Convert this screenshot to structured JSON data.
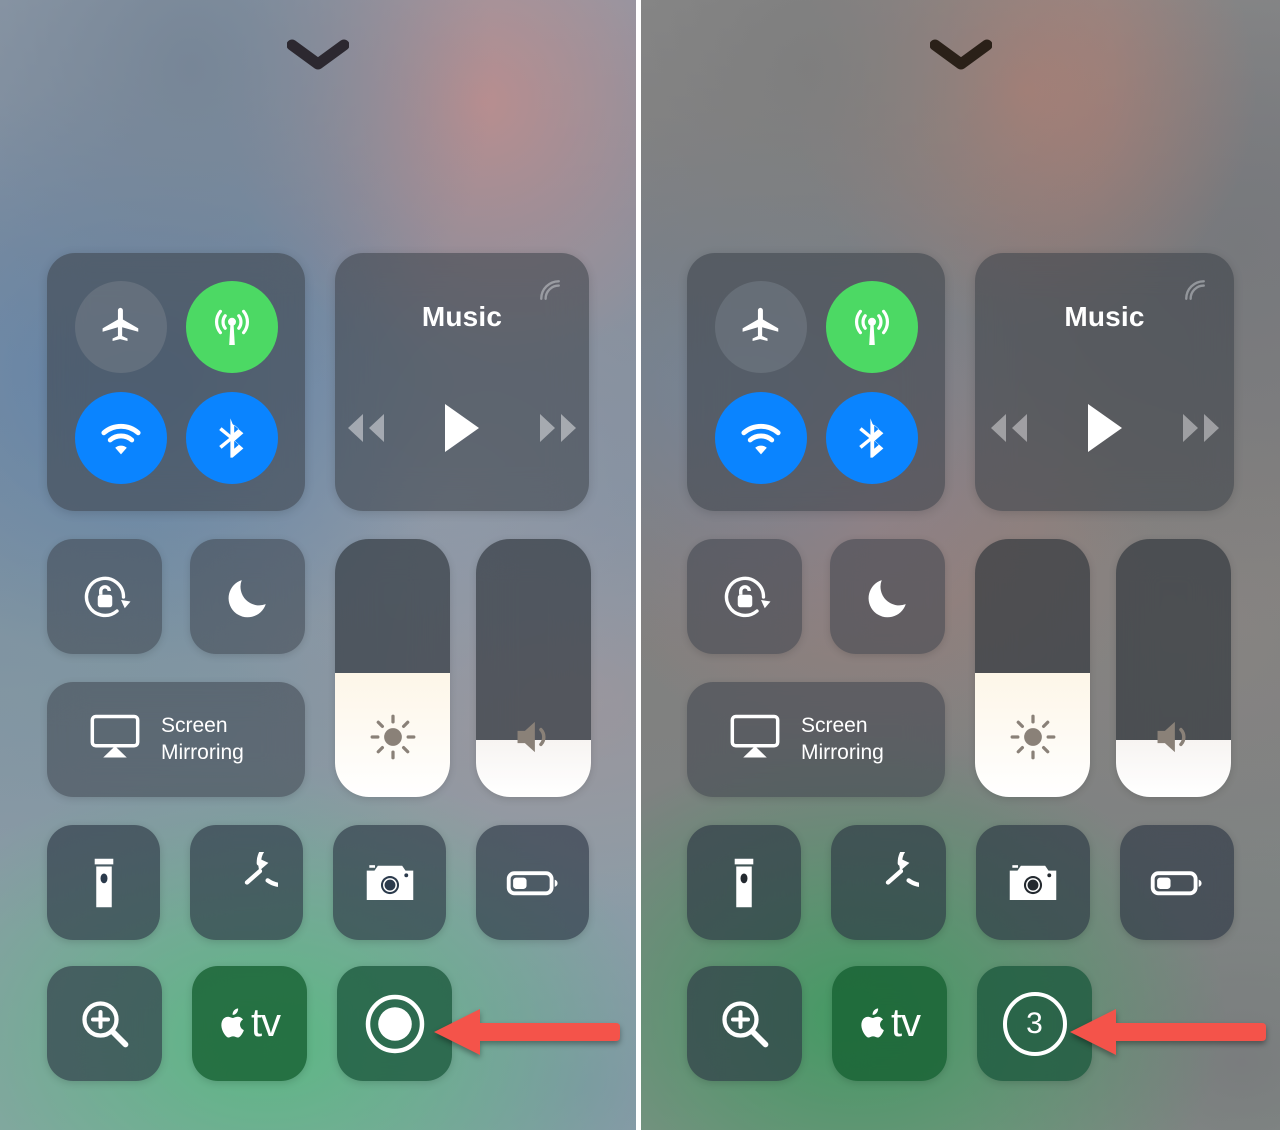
{
  "screenshot": {
    "title": "iOS Control Center comparison",
    "panels": [
      {
        "id": "before",
        "chevron": "chevron-down-icon",
        "connectivity": {
          "airplane": {
            "label": "Airplane Mode",
            "icon": "airplane-icon",
            "state": "off",
            "color": "#78808a"
          },
          "cellular": {
            "label": "Cellular Data",
            "icon": "cellular-antenna-icon",
            "state": "on",
            "color": "#4cd964"
          },
          "wifi": {
            "label": "Wi-Fi",
            "icon": "wifi-icon",
            "state": "on",
            "color": "#0a84ff"
          },
          "bluetooth": {
            "label": "Bluetooth",
            "icon": "bluetooth-icon",
            "state": "on",
            "color": "#0a84ff"
          }
        },
        "music": {
          "title": "Music",
          "airplay_icon": "airplay-audio-icon",
          "rewind_icon": "rewind-icon",
          "play_icon": "play-icon",
          "forward_icon": "fast-forward-icon",
          "playing": false
        },
        "orientation_lock": {
          "label": "Rotation Lock",
          "icon": "rotation-lock-icon",
          "state": "off"
        },
        "do_not_disturb": {
          "label": "Do Not Disturb",
          "icon": "moon-icon",
          "state": "off"
        },
        "screen_mirroring": {
          "line1": "Screen",
          "line2": "Mirroring",
          "icon": "airplay-screen-icon"
        },
        "brightness": {
          "label": "Brightness",
          "icon": "sun-icon",
          "value": 48
        },
        "volume": {
          "label": "Volume",
          "icon": "speaker-icon",
          "value": 22
        },
        "tiles": [
          {
            "label": "Flashlight",
            "icon": "flashlight-icon",
            "style": "dark"
          },
          {
            "label": "Timer",
            "icon": "timer-icon",
            "style": "dark"
          },
          {
            "label": "Camera",
            "icon": "camera-icon",
            "style": "dark"
          },
          {
            "label": "Low Power Mode",
            "icon": "battery-icon",
            "style": "dark"
          },
          {
            "label": "Magnifier",
            "icon": "magnifier-plus-icon",
            "style": "dark"
          },
          {
            "label": "Apple TV Remote",
            "icon": "apple-tv-icon",
            "style": "green",
            "text": "tv"
          },
          {
            "label": "Screen Recording",
            "icon": "record-icon",
            "style": "greenrec"
          }
        ],
        "annotation": {
          "type": "arrow-left",
          "color": "#f4534a",
          "points_to": "Screen Recording"
        }
      },
      {
        "id": "after",
        "chevron": "chevron-down-icon",
        "connectivity": {
          "airplane": {
            "label": "Airplane Mode",
            "icon": "airplane-icon",
            "state": "off",
            "color": "#78808a"
          },
          "cellular": {
            "label": "Cellular Data",
            "icon": "cellular-antenna-icon",
            "state": "on",
            "color": "#4cd964"
          },
          "wifi": {
            "label": "Wi-Fi",
            "icon": "wifi-icon",
            "state": "on",
            "color": "#0a84ff"
          },
          "bluetooth": {
            "label": "Bluetooth",
            "icon": "bluetooth-icon",
            "state": "on",
            "color": "#0a84ff"
          }
        },
        "music": {
          "title": "Music",
          "airplay_icon": "airplay-audio-icon",
          "rewind_icon": "rewind-icon",
          "play_icon": "play-icon",
          "forward_icon": "fast-forward-icon",
          "playing": false
        },
        "orientation_lock": {
          "label": "Rotation Lock",
          "icon": "rotation-lock-icon",
          "state": "off"
        },
        "do_not_disturb": {
          "label": "Do Not Disturb",
          "icon": "moon-icon",
          "state": "off"
        },
        "screen_mirroring": {
          "line1": "Screen",
          "line2": "Mirroring",
          "icon": "airplay-screen-icon"
        },
        "brightness": {
          "label": "Brightness",
          "icon": "sun-icon",
          "value": 48
        },
        "volume": {
          "label": "Volume",
          "icon": "speaker-icon",
          "value": 22
        },
        "tiles": [
          {
            "label": "Flashlight",
            "icon": "flashlight-icon",
            "style": "dark"
          },
          {
            "label": "Timer",
            "icon": "timer-icon",
            "style": "dark"
          },
          {
            "label": "Camera",
            "icon": "camera-icon",
            "style": "dark"
          },
          {
            "label": "Low Power Mode",
            "icon": "battery-icon",
            "style": "dark"
          },
          {
            "label": "Magnifier",
            "icon": "magnifier-plus-icon",
            "style": "dark"
          },
          {
            "label": "Apple TV Remote",
            "icon": "apple-tv-icon",
            "style": "green",
            "text": "tv"
          },
          {
            "label": "Screen Recording",
            "icon": "countdown-icon",
            "style": "greenrec",
            "countdown": "3"
          }
        ],
        "annotation": {
          "type": "arrow-left",
          "color": "#f4534a",
          "points_to": "Screen Recording countdown"
        }
      }
    ]
  }
}
